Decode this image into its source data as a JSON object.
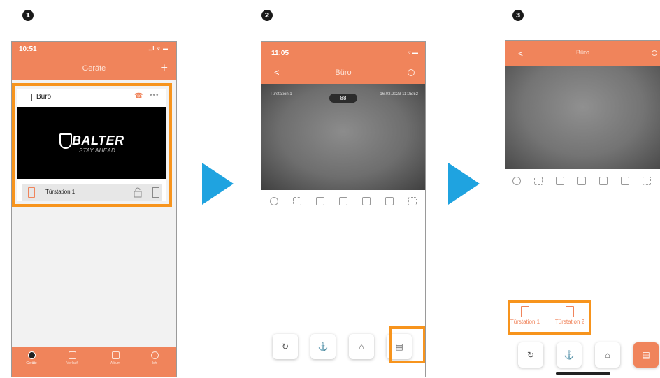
{
  "steps": [
    "1",
    "2",
    "3"
  ],
  "colors": {
    "accent": "#f0845b",
    "highlight": "#f7941d",
    "arrow": "#1fa3e0"
  },
  "screen1": {
    "time": "10:51",
    "signal": "‥l ▿ ▬",
    "title": "Geräte",
    "add_icon": "+",
    "device": {
      "name": "Büro",
      "brand": "BALTER",
      "slogan": "STAY AHEAD",
      "more": "•••",
      "call": "☎"
    },
    "station": {
      "name": "Türstation 1"
    },
    "tabs": [
      {
        "label": "Geräte",
        "icon": "devices-icon"
      },
      {
        "label": "Verlauf",
        "icon": "history-icon"
      },
      {
        "label": "Album",
        "icon": "album-icon"
      },
      {
        "label": "Ich",
        "icon": "profile-icon"
      }
    ]
  },
  "screen2": {
    "time": "11:05",
    "signal": "‥l ▿ ▬",
    "title": "Büro",
    "back": "<",
    "video": {
      "label": "Türstation 1",
      "badge": "88",
      "datetime": "16.03.2023 11:05:52"
    },
    "buttons": [
      "↻",
      "⚓",
      "⌂",
      "▤"
    ]
  },
  "screen3": {
    "title": "Büro",
    "back": "<",
    "stations": [
      "Türstation 1",
      "Türstation 2"
    ],
    "buttons": [
      "↻",
      "⚓",
      "⌂",
      "▤"
    ]
  }
}
